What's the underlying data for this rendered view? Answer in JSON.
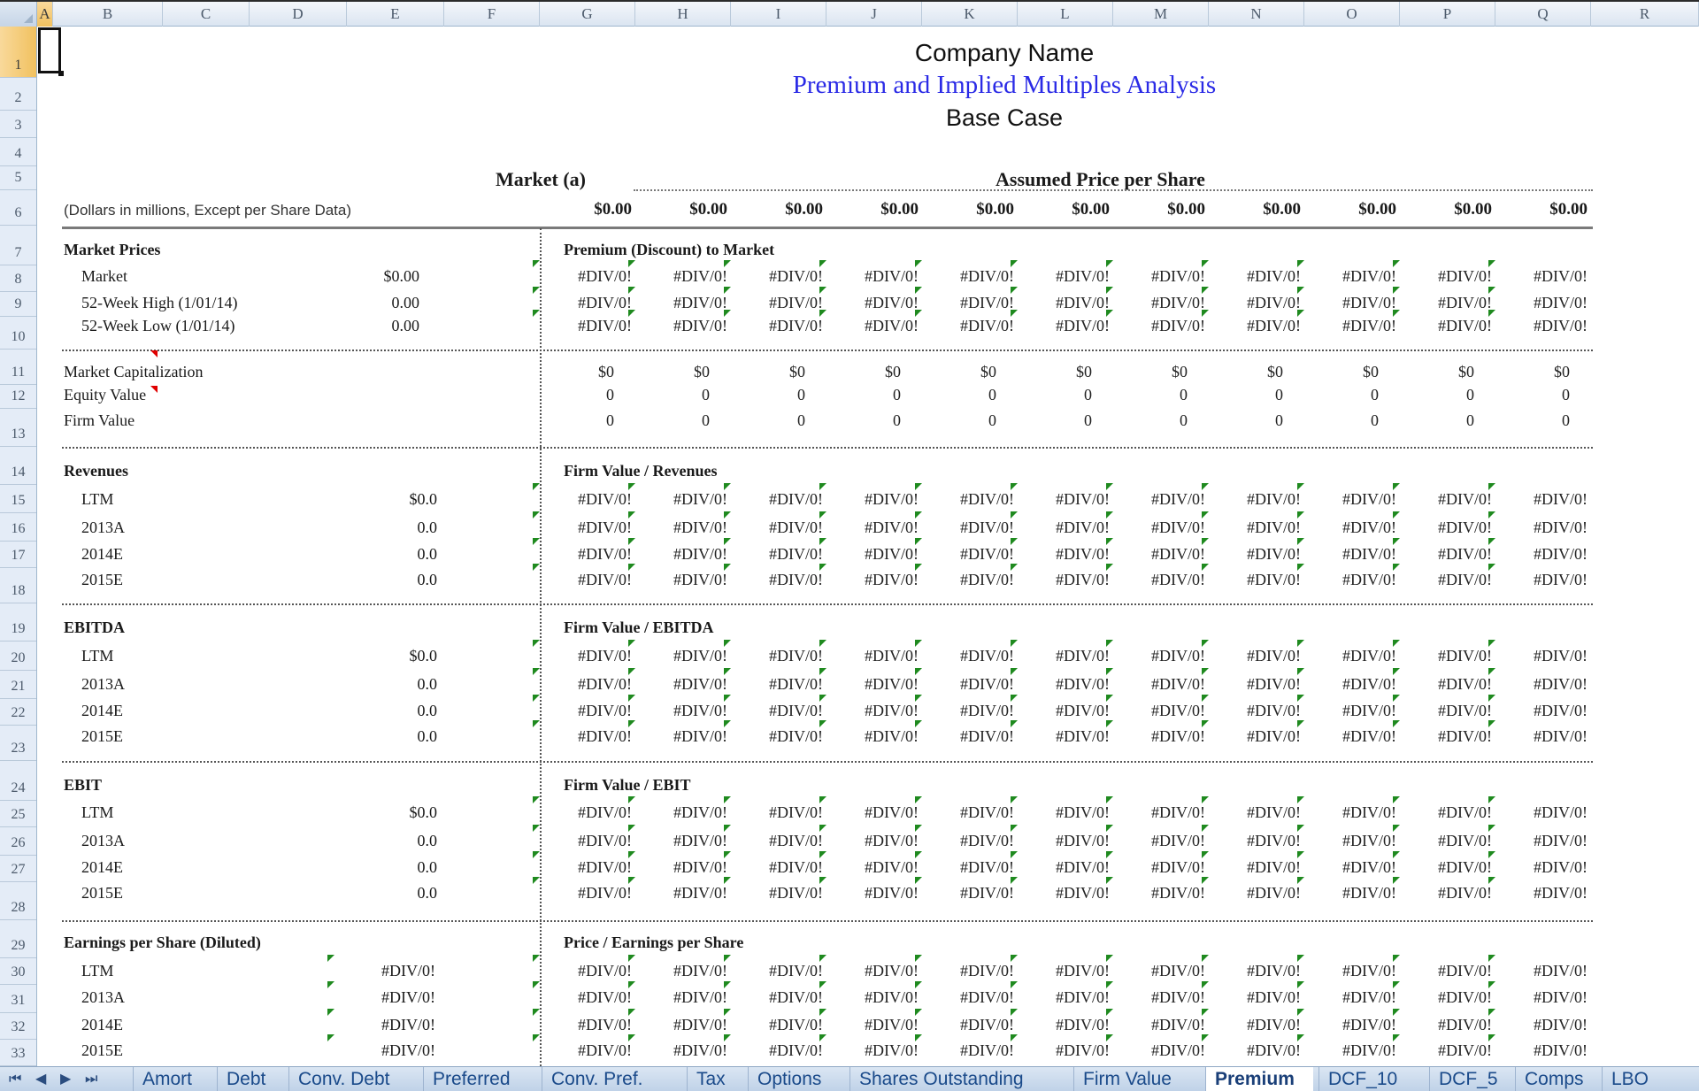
{
  "columns": [
    "A",
    "B",
    "C",
    "D",
    "E",
    "F",
    "G",
    "H",
    "I",
    "J",
    "K",
    "L",
    "M",
    "N",
    "O",
    "P",
    "Q",
    "R"
  ],
  "selected_column": "A",
  "rows": [
    "1",
    "2",
    "3",
    "4",
    "5",
    "6",
    "7",
    "8",
    "9",
    "10",
    "11",
    "12",
    "13",
    "14",
    "15",
    "16",
    "17",
    "18",
    "19",
    "20",
    "21",
    "22",
    "23",
    "24",
    "25",
    "26",
    "27",
    "28",
    "29",
    "30",
    "31",
    "32",
    "33"
  ],
  "selected_row": "1",
  "title": {
    "company": "Company Name",
    "analysis": "Premium and Implied Multiples Analysis",
    "case": "Base Case"
  },
  "headers": {
    "market": "Market (a)",
    "assumed": "Assumed Price per Share",
    "units": "(Dollars in millions, Except per Share Data)",
    "prices": [
      "$0.00",
      "$0.00",
      "$0.00",
      "$0.00",
      "$0.00",
      "$0.00",
      "$0.00",
      "$0.00",
      "$0.00",
      "$0.00",
      "$0.00"
    ]
  },
  "sections": {
    "market_prices": {
      "label": "Market Prices",
      "right_title": "Premium (Discount) to Market",
      "rows": [
        {
          "label": "Market",
          "value": "$0.00"
        },
        {
          "label": "52-Week High (1/01/14)",
          "value": "0.00"
        },
        {
          "label": "52-Week Low  (1/01/14)",
          "value": "0.00"
        }
      ],
      "cell_value": "#DIV/0!"
    },
    "valuation": {
      "rows": [
        {
          "label": "Market Capitalization",
          "cells": [
            "$0",
            "$0",
            "$0",
            "$0",
            "$0",
            "$0",
            "$0",
            "$0",
            "$0",
            "$0",
            "$0"
          ]
        },
        {
          "label": "Equity Value",
          "cells": [
            "0",
            "0",
            "0",
            "0",
            "0",
            "0",
            "0",
            "0",
            "0",
            "0",
            "0"
          ]
        },
        {
          "label": "Firm Value",
          "cells": [
            "0",
            "0",
            "0",
            "0",
            "0",
            "0",
            "0",
            "0",
            "0",
            "0",
            "0"
          ]
        }
      ]
    },
    "revenues": {
      "label": "Revenues",
      "right_title": "Firm Value / Revenues",
      "rows": [
        {
          "label": "LTM",
          "value": "$0.0"
        },
        {
          "label": "2013A",
          "value": "0.0"
        },
        {
          "label": "2014E",
          "value": "0.0"
        },
        {
          "label": "2015E",
          "value": "0.0"
        }
      ],
      "cell_value": "#DIV/0!"
    },
    "ebitda": {
      "label": "EBITDA",
      "right_title": "Firm Value / EBITDA",
      "rows": [
        {
          "label": "LTM",
          "value": "$0.0"
        },
        {
          "label": "2013A",
          "value": "0.0"
        },
        {
          "label": "2014E",
          "value": "0.0"
        },
        {
          "label": "2015E",
          "value": "0.0"
        }
      ],
      "cell_value": "#DIV/0!"
    },
    "ebit": {
      "label": "EBIT",
      "right_title": "Firm Value / EBIT",
      "rows": [
        {
          "label": "LTM",
          "value": "$0.0"
        },
        {
          "label": "2013A",
          "value": "0.0"
        },
        {
          "label": "2014E",
          "value": "0.0"
        },
        {
          "label": "2015E",
          "value": "0.0"
        }
      ],
      "cell_value": "#DIV/0!"
    },
    "eps": {
      "label": "Earnings per Share (Diluted)",
      "right_title": "Price / Earnings per Share",
      "rows": [
        {
          "label": "LTM",
          "value": "#DIV/0!"
        },
        {
          "label": "2013A",
          "value": "#DIV/0!"
        },
        {
          "label": "2014E",
          "value": "#DIV/0!"
        },
        {
          "label": "2015E",
          "value": "#DIV/0!"
        }
      ],
      "cell_value": "#DIV/0!"
    }
  },
  "sheet_tabs": {
    "nav": [
      "first-sheet",
      "prev-sheet",
      "next-sheet",
      "last-sheet"
    ],
    "tabs": [
      "Amort",
      "Debt",
      "Conv. Debt",
      "Preferred",
      "Conv. Pref.",
      "Tax",
      "Options",
      "Shares Outstanding",
      "Firm Value",
      "Premium",
      "DCF_10",
      "DCF_5",
      "Comps",
      "LBO"
    ],
    "active": "Premium"
  },
  "colors": {
    "analysis_title": "#2a2ae6",
    "error_flag": "#1f8a1f",
    "comment_flag": "#e00000",
    "selection": "#f1c15f"
  }
}
